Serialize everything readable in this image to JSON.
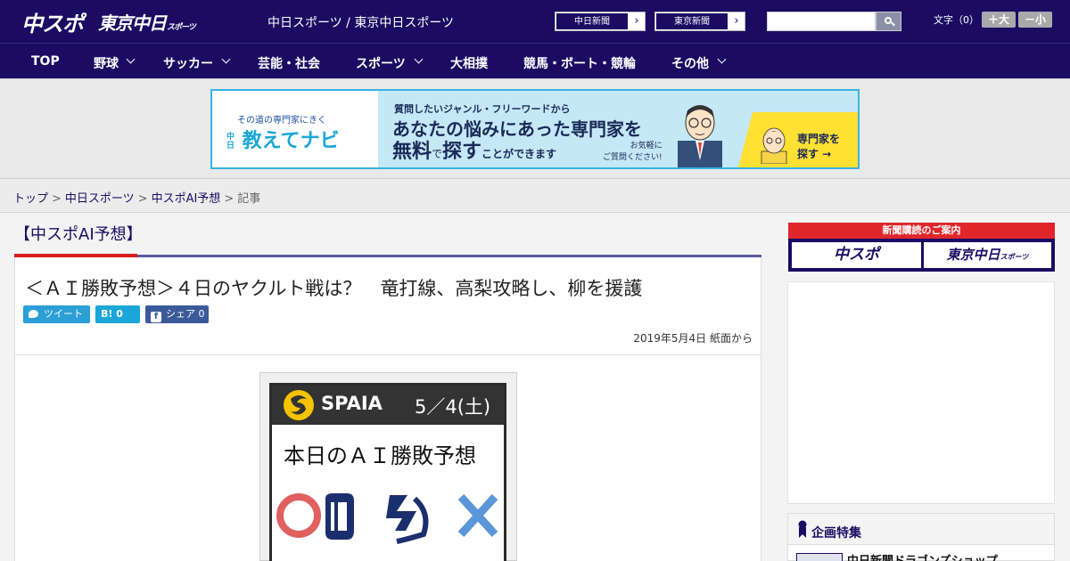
{
  "header": {
    "logo_chuspo": "中スポ",
    "logo_tokyo": "東京中日",
    "logo_tokyo_suffix": "スポーツ",
    "site_title": "中日スポーツ / 東京中日スポーツ",
    "btn_chunichi": "中日新聞",
    "btn_tokyo": "東京新聞",
    "arrow": "›",
    "font_label": "文字（0）",
    "font_big": "＋大",
    "font_small": "－小"
  },
  "nav": {
    "items": [
      "TOP",
      "野球",
      "サッカー",
      "芸能・社会",
      "スポーツ",
      "大相撲",
      "競馬・ボート・競輪",
      "その他"
    ]
  },
  "banner": {
    "sub": "その道の専門家にきく",
    "logo_chu": "中日",
    "logo": "教えてナビ",
    "line1": "質問したいジャンル・フリーワードから",
    "line2": "あなたの悩みにあった専門家を",
    "line3_a": "無料",
    "line3_b": "で",
    "line3_c": "探す",
    "line3_d": "ことができます",
    "note1": "お気軽に",
    "note2": "ご質問ください!",
    "cta1": "専門家を",
    "cta2": "探す →"
  },
  "breadcrumb": {
    "items": [
      "トップ",
      "中日スポーツ",
      "中スポAI予想"
    ],
    "current": "記事",
    "sep": ">"
  },
  "article": {
    "category": "【中スポAI予想】",
    "title": "＜ＡＩ勝敗予想＞４日のヤクルト戦は？　竜打線、高梨攻略し、柳を援護",
    "tweet": "ツイート",
    "hatena": "B! 0",
    "share": "シェア 0",
    "date": "2019年5月4日 紙面から",
    "image": {
      "brand": "SPAIA",
      "date": "5／4(土)",
      "headline": "本日のＡＩ勝敗予想"
    }
  },
  "sidebar": {
    "subscribe": "新聞購読のご案内",
    "logo1": "中スポ",
    "logo2": "東京中日",
    "logo2_suffix": "スポーツ",
    "feature_title": "企画特集",
    "feature_item": "中日新聞ドラゴンズショップ"
  },
  "colors": {
    "header_bg": "#1b0b63",
    "accent_red": "#d71b1b",
    "twitter": "#2c9fd6",
    "facebook": "#3b5a9a"
  }
}
